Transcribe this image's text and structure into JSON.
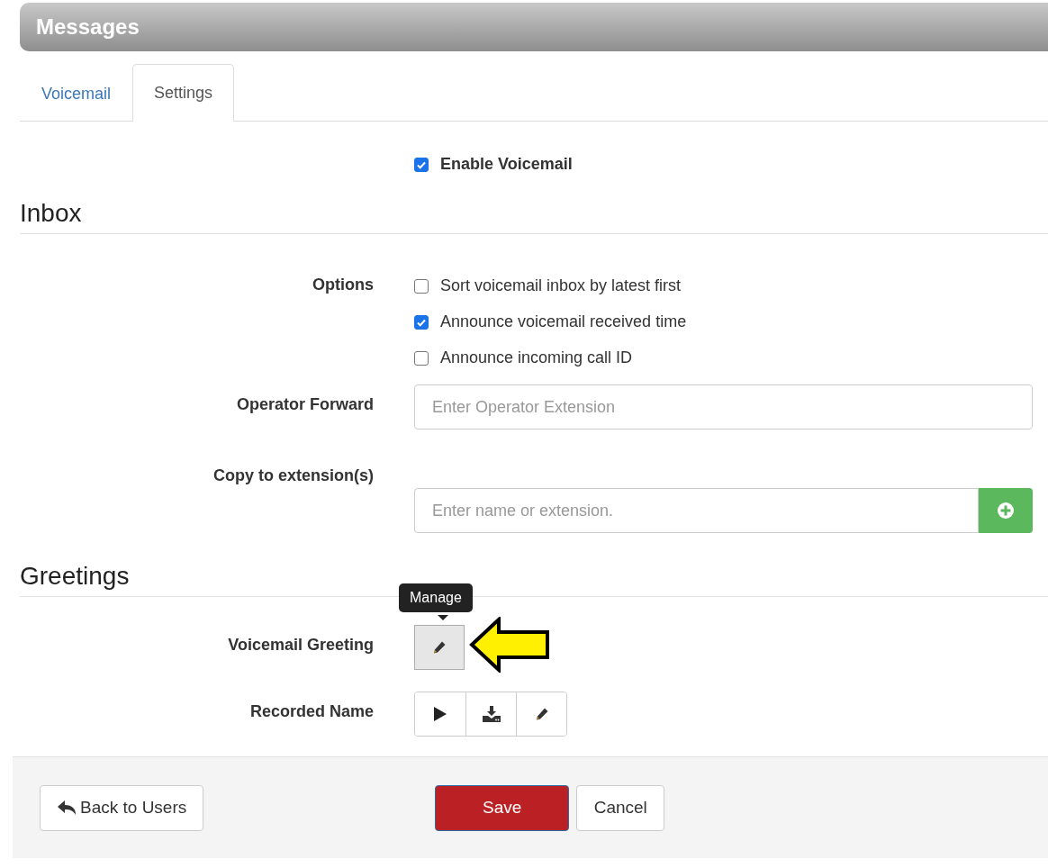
{
  "header": {
    "title": "Messages"
  },
  "tabs": [
    {
      "label": "Voicemail",
      "selected": false
    },
    {
      "label": "Settings",
      "selected": true
    }
  ],
  "enable": {
    "label": "Enable Voicemail",
    "checked": true
  },
  "sections": [
    {
      "title": "Inbox",
      "rows": [
        {
          "kind": "checks",
          "label": "Options",
          "options": [
            {
              "label": "Sort voicemail inbox by latest first",
              "checked": false
            },
            {
              "label": "Announce voicemail received time",
              "checked": true
            },
            {
              "label": "Announce incoming call ID",
              "checked": false
            }
          ]
        },
        {
          "kind": "text",
          "label": "Operator Forward",
          "placeholder": "Enter Operator Extension"
        },
        {
          "kind": "add",
          "label": "Copy to extension(s)",
          "placeholder": "Enter name or extension."
        }
      ]
    },
    {
      "title": "Greetings",
      "rows": [
        {
          "kind": "manage",
          "label": "Voicemail Greeting",
          "tooltip": "Manage"
        },
        {
          "kind": "media",
          "label": "Recorded Name"
        }
      ]
    }
  ],
  "footer": {
    "back": "Back to Users",
    "save": "Save",
    "cancel": "Cancel"
  }
}
